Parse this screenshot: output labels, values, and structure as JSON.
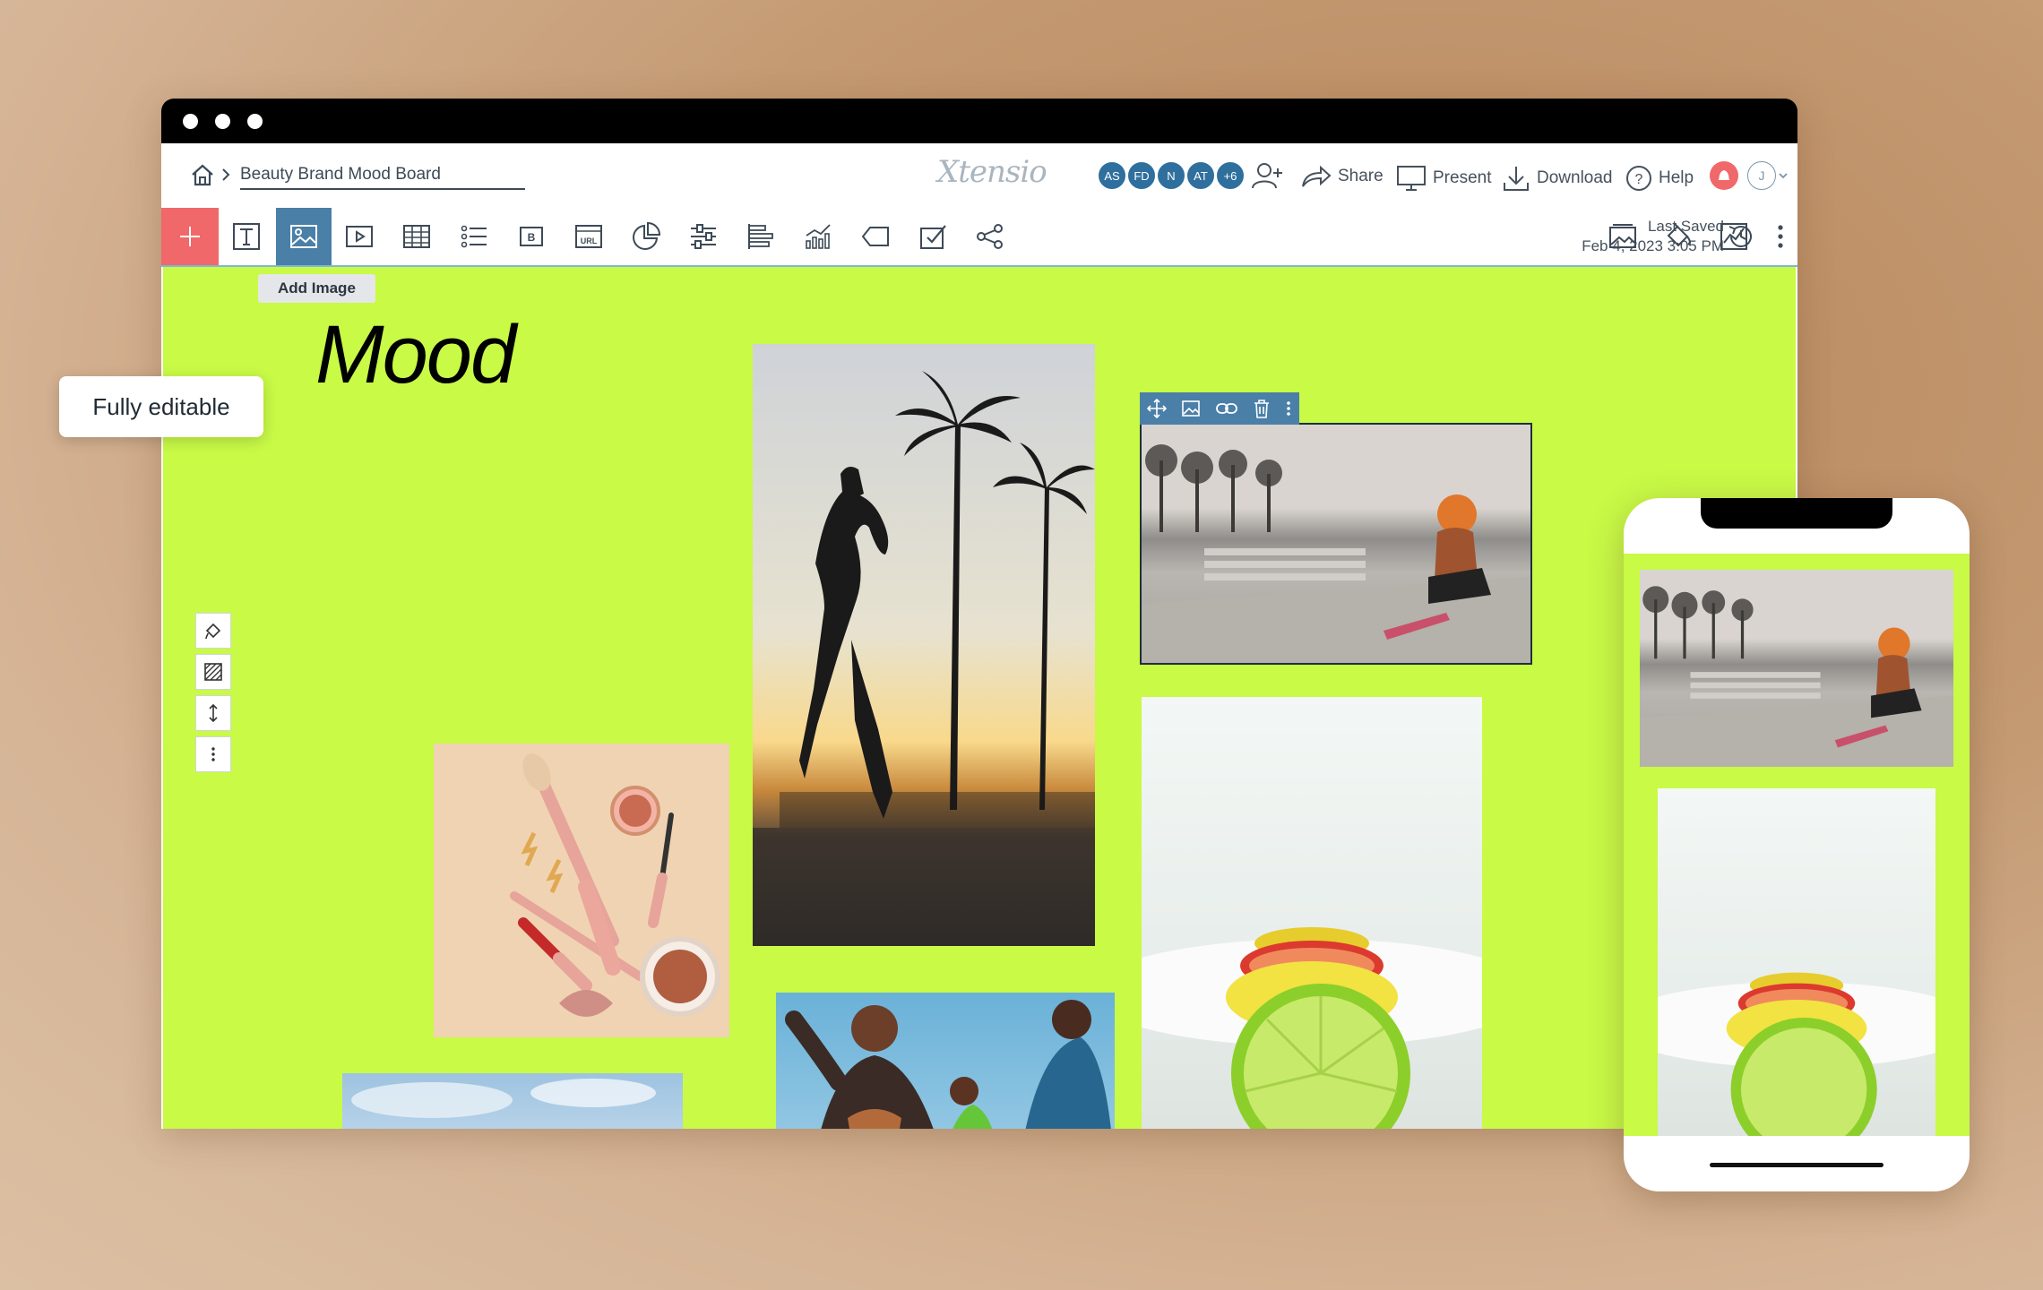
{
  "header": {
    "breadcrumb_title": "Beauty Brand Mood Board",
    "logo": "Xtensio",
    "avatars": [
      "AS",
      "FD",
      "N",
      "AT",
      "+6"
    ],
    "actions": {
      "share": "Share",
      "present": "Present",
      "download": "Download",
      "help": "Help",
      "user_initial": "J"
    }
  },
  "toolbar": {
    "last_saved_label": "Last Saved",
    "last_saved_time": "Feb 4, 2023 3:05 PM",
    "tooltip": "Add Image",
    "tools": [
      "add",
      "text",
      "image",
      "video",
      "table",
      "list",
      "button",
      "url",
      "pie-chart",
      "slider",
      "bars",
      "bar-chart",
      "tag",
      "form",
      "share-nodes"
    ]
  },
  "canvas": {
    "heading": "Mood",
    "background": "#c8fa46"
  },
  "callout": {
    "text": "Fully editable"
  },
  "colors": {
    "accent": "#4a7fa8",
    "add_button": "#f0686a",
    "canvas_green": "#c8fa46",
    "avatar_blue": "#2f6f9e"
  }
}
